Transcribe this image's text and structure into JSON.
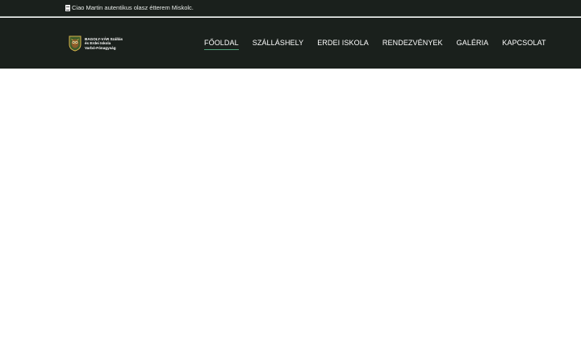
{
  "topbar": {
    "link_text": "Ciao Martin autentikus olasz étterem Miskolc.",
    "icon": "document-icon"
  },
  "brand": {
    "lines": [
      "BAGOLY-VÁR Szállás",
      "és Erdei Iskola",
      "Varbó-Fónagyság"
    ],
    "logo": "owl-shield-logo"
  },
  "nav": {
    "items": [
      {
        "label": "FŐOLDAL",
        "active": true
      },
      {
        "label": "SZÁLLÁSHELY",
        "active": false
      },
      {
        "label": "ERDEI ISKOLA",
        "active": false
      },
      {
        "label": "RENDEZVÉNYEK",
        "active": false
      },
      {
        "label": "GALÉRIA",
        "active": false
      },
      {
        "label": "KAPCSOLAT",
        "active": false
      }
    ]
  },
  "colors": {
    "header_bg": "#1a201c",
    "accent": "#4fa07a",
    "text": "#ffffff"
  }
}
